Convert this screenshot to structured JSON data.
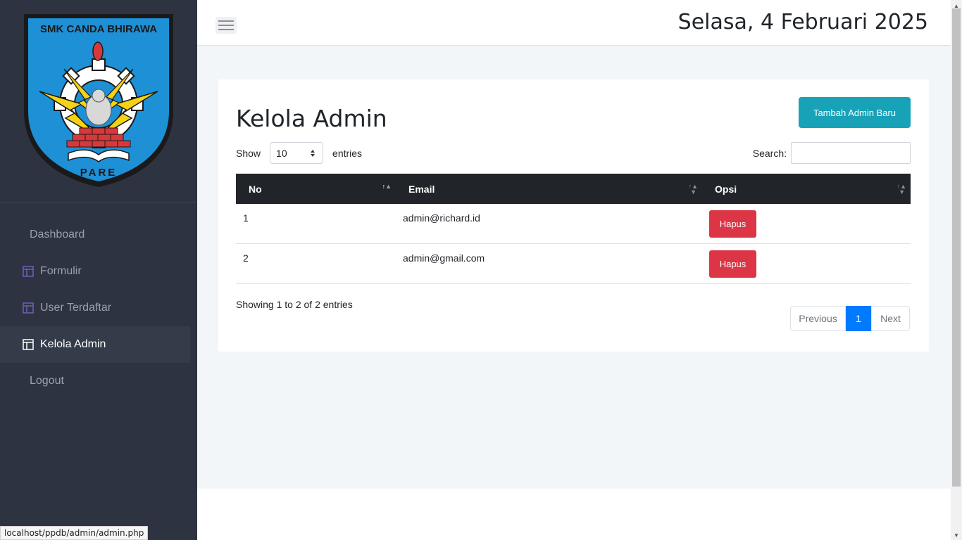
{
  "sidebar": {
    "logo": {
      "top_text": "SMK CANDA BHIRAWA",
      "bottom_text": "PARE"
    },
    "items": [
      {
        "label": "Dashboard",
        "icon": ""
      },
      {
        "label": "Formulir",
        "icon": "layout-icon"
      },
      {
        "label": "User Terdaftar",
        "icon": "layout-icon"
      },
      {
        "label": "Kelola Admin",
        "icon": "layout-icon",
        "active": true
      },
      {
        "label": "Logout",
        "icon": ""
      }
    ]
  },
  "header": {
    "date": "Selasa, 4 Februari 2025",
    "menu_icon": "hamburger-icon"
  },
  "main": {
    "title": "Kelola Admin",
    "add_button": "Tambah Admin Baru",
    "show_label": "Show",
    "entries_value": "10",
    "entries_label": "entries",
    "search_label": "Search:",
    "table": {
      "columns": [
        "No",
        "Email",
        "Opsi"
      ],
      "rows": [
        {
          "no": "1",
          "email": "admin@richard.id",
          "action": "Hapus"
        },
        {
          "no": "2",
          "email": "admin@gmail.com",
          "action": "Hapus"
        }
      ]
    },
    "info": "Showing 1 to 2 of 2 entries",
    "pagination": {
      "prev": "Previous",
      "current": "1",
      "next": "Next"
    }
  },
  "statusbar": {
    "url": "localhost/ppdb/admin/admin.php"
  },
  "colors": {
    "sidebar_bg": "#2d3341",
    "accent_add": "#17a2b8",
    "danger": "#dc3545",
    "primary": "#007bff",
    "table_header": "#212529"
  }
}
